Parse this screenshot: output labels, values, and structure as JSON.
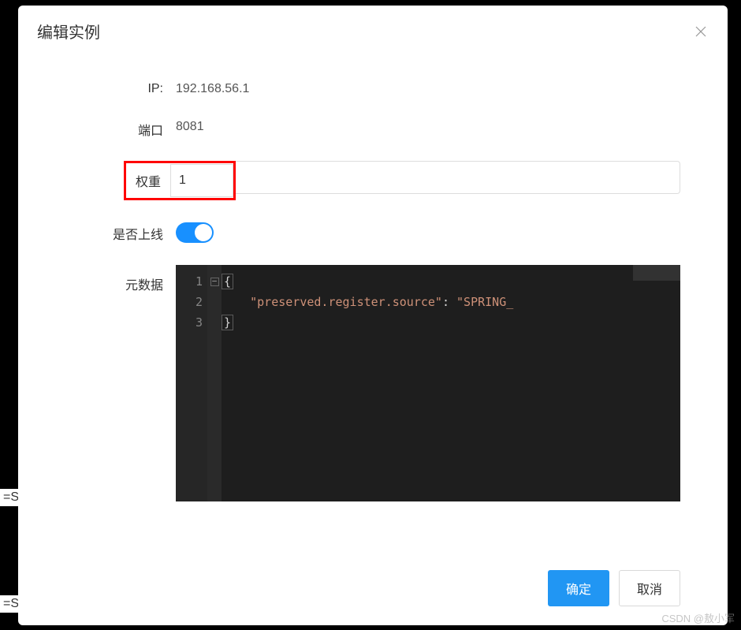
{
  "modal": {
    "title": "编辑实例",
    "labels": {
      "ip": "IP:",
      "port": "端口",
      "weight": "权重",
      "online": "是否上线",
      "metadata": "元数据"
    },
    "values": {
      "ip": "192.168.56.1",
      "port": "8081",
      "weight": "1"
    },
    "code": {
      "line1_num": "1",
      "line2_num": "2",
      "line3_num": "3",
      "open_brace": "{",
      "close_brace": "}",
      "key": "\"preserved.register.source\"",
      "colon": ": ",
      "value": "\"SPRING_"
    },
    "buttons": {
      "confirm": "确定",
      "cancel": "取消"
    }
  },
  "backdrop": {
    "eq_s": "=S"
  },
  "watermark": "CSDN @敖小军"
}
